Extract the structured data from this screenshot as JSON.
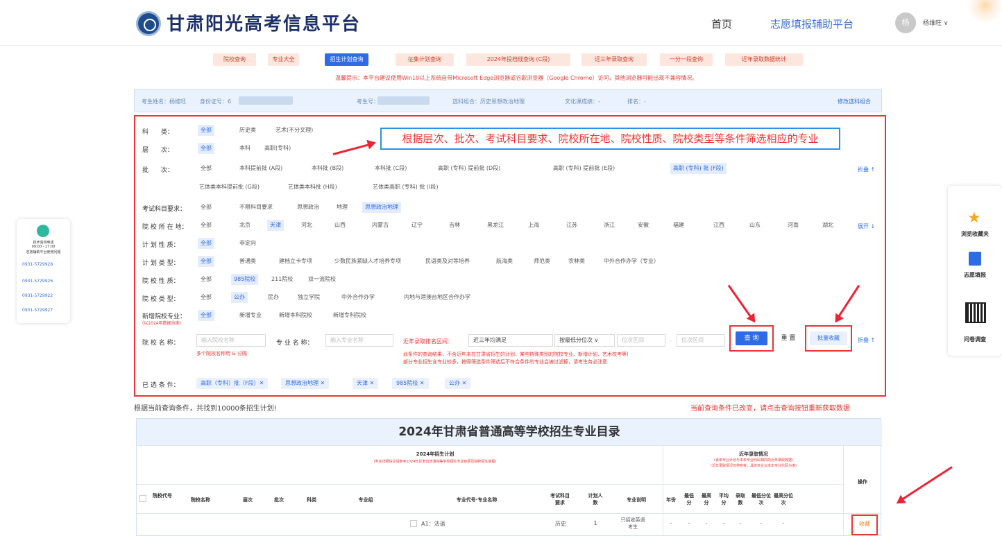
{
  "header": {
    "site_title": "甘肃阳光高考信息平台",
    "nav_home": "首页",
    "nav_zhiyuan": "志愿填报辅助平台",
    "avatar_text": "杨",
    "username": "杨维旺 ∨"
  },
  "tabs": [
    {
      "label": "院校查询",
      "active": false
    },
    {
      "label": "专业大全",
      "active": false
    },
    {
      "label": "招生计划查询",
      "active": true
    },
    {
      "label": "征集计划查询",
      "active": false
    },
    {
      "label": "2024年投档线查询 (C段)",
      "active": false
    },
    {
      "label": "近三年录取查询",
      "active": false
    },
    {
      "label": "一分一段查询",
      "active": false
    },
    {
      "label": "近年录取数据统计",
      "active": false
    }
  ],
  "notice": "温馨提示：本平台建议使用Win10以上系统自带Microsoft Edge浏览器或谷歌浏览器（Google Chrome）访问，其他浏览器可能出现不兼容情况。",
  "student": {
    "name": "考生姓名：杨维旺",
    "id": "身份证号：6",
    "exam_no": "考生号：2",
    "subjects": "选科组合：历史思想政治地理",
    "score": "文化课成绩：-",
    "rank": "排名：-",
    "edit": "修改选科组合"
  },
  "callout": "根据层次、批次、考试科目要求、院校所在地、院校性质、院校类型等条件筛选相应的专业",
  "filters": {
    "kelei": {
      "label": "科　　类：",
      "options": [
        "全部",
        "历史类",
        "艺术(不分文理)"
      ]
    },
    "cengci": {
      "label": "层　　次：",
      "options": [
        "全部",
        "本科",
        "高职(专科)"
      ]
    },
    "pici": {
      "label": "批　　次：",
      "options": [
        "全部",
        "本科提前批 (A段)",
        "本科批 (B段)",
        "本科批 (C段)",
        "高职 (专科) 提前批 (D段)",
        "高职 (专科) 提前批 (E段)",
        "高职 (专科) 批 (F段)",
        "艺体类本科提前批 (G段)",
        "艺体类本科批 (H段)",
        "艺体类高职 (专科) 批 (I段)"
      ],
      "toggle": "折叠 ↑"
    },
    "kaoshi": {
      "label": "考试科目要求：",
      "options": [
        "全部",
        "不限科目要求",
        "思想政治",
        "地理",
        "思想政治地理"
      ]
    },
    "suozaidi": {
      "label": "院 校 所 在 地：",
      "options": [
        "全部",
        "北京",
        "天津",
        "河北",
        "山西",
        "内蒙古",
        "辽宁",
        "吉林",
        "黑龙江",
        "上海",
        "江苏",
        "浙江",
        "安徽",
        "福建",
        "江西",
        "山东",
        "河南",
        "湖北"
      ],
      "toggle": "展开 ↓"
    },
    "jihuaxingzhi": {
      "label": "计 划 性 质：",
      "options": [
        "全部",
        "非定向"
      ]
    },
    "jihualeixing": {
      "label": "计 划 类 型：",
      "options": [
        "全部",
        "普通类",
        "建档立卡专项",
        "少数民族紧缺人才培养专项",
        "民语类及对等培养",
        "航海类",
        "师范类",
        "农林类",
        "中外合作办学（专业）"
      ]
    },
    "yuanxiaoxingzhi": {
      "label": "院 校 性 质：",
      "options": [
        "全部",
        "985院校",
        "211院校",
        "双一流院校"
      ]
    },
    "yuanxiaoleixing": {
      "label": "院 校 类 型：",
      "options": [
        "全部",
        "公办",
        "民办",
        "独立学院",
        "中外合作办学",
        "内地与港澳台地区合作办学"
      ]
    },
    "xinzeng": {
      "label": "新增院校专业：",
      "sub": "(以2024年数据为准)",
      "options": [
        "全部",
        "新增专业",
        "新增本科院校",
        "新增专科院校"
      ]
    }
  },
  "search": {
    "school_label": "院 校 名 称：",
    "school_placeholder": "输入院校名称",
    "school_hint": "多个院校名称用 & 分隔",
    "major_label": "专 业 名 称：",
    "major_placeholder": "输入专业名称",
    "range_label": "近年录取排名区间：",
    "range_value": "近三年均满足",
    "range_mode": "按最低分位次 ∨",
    "range_from": "位次区间",
    "range_to": "位次区间",
    "range_hint1": "此条件的查询结果，不含近年未在甘肃省招生的计划、某些特殊类别的院校专业、新增计划、艺术校考等)",
    "range_hint2": "部分专业招生含专业较多，按照筛选条件筛选后不符合条件的专业会被过滤掉，请考生务必注意",
    "query_btn": "查 询",
    "reset_btn": "重 置",
    "batch_btn": "批量收藏",
    "fold": "折叠 ↑"
  },
  "selected": {
    "label": "已 选 条 件：",
    "chips": [
      "高职（专科）批（F段）✕",
      "思想政治地理 ✕",
      "天津 ✕",
      "985院校 ✕",
      "公办 ✕"
    ]
  },
  "results": {
    "count": "根据当前查询条件，共找到10000条招生计划!",
    "warn": "当前查询条件已改变，请点击查询按钮重新获取数据"
  },
  "table": {
    "title": "2024年甘肃省普通高等学校招生专业目录",
    "plan_group": "2024年招生计划",
    "plan_group_note": "(专业详细信息请参考2024年甘肃省普通高等学校招生专业目录及院校招生章程)",
    "history_group": "近年录取情况",
    "history_note1": "(该年专业计划与本年专业代码相同的近年录取数据)",
    "history_note2": "(近年录取情况仅供参考，具体专业以本年专业代码为准)",
    "headers": [
      "院校代号",
      "院校名称",
      "层次",
      "批次",
      "科类",
      "专业组",
      "专业代号·专业名称",
      "考试科目要求",
      "计划人数",
      "专业说明",
      "年份",
      "最低分",
      "最高分",
      "平均分",
      "录取数",
      "最低分位次",
      "最高分位次",
      "操作"
    ],
    "row": {
      "major": "A1：法语",
      "subject": "历史",
      "plan": "1",
      "note": "只招收英语考生",
      "year": "-",
      "min": "-",
      "max": "-",
      "avg": "-",
      "cnt": "-",
      "minrank": "-",
      "maxrank": "-",
      "action": "收藏"
    }
  },
  "left_panel": {
    "title": "技术咨询电话",
    "hours": "09:00 - 17:00",
    "note": "志愿辅助平台使用问题",
    "phones": [
      "0931-5729928",
      "0931-5729926",
      "0931-5729922",
      "0931-5729927"
    ]
  },
  "right_panel": {
    "items": [
      "浏览收藏夹",
      "志愿填报",
      "问卷调查"
    ]
  },
  "colors": {
    "accent": "#2e6be6",
    "highlight": "#e33333",
    "brand": "#1d2f6b"
  }
}
